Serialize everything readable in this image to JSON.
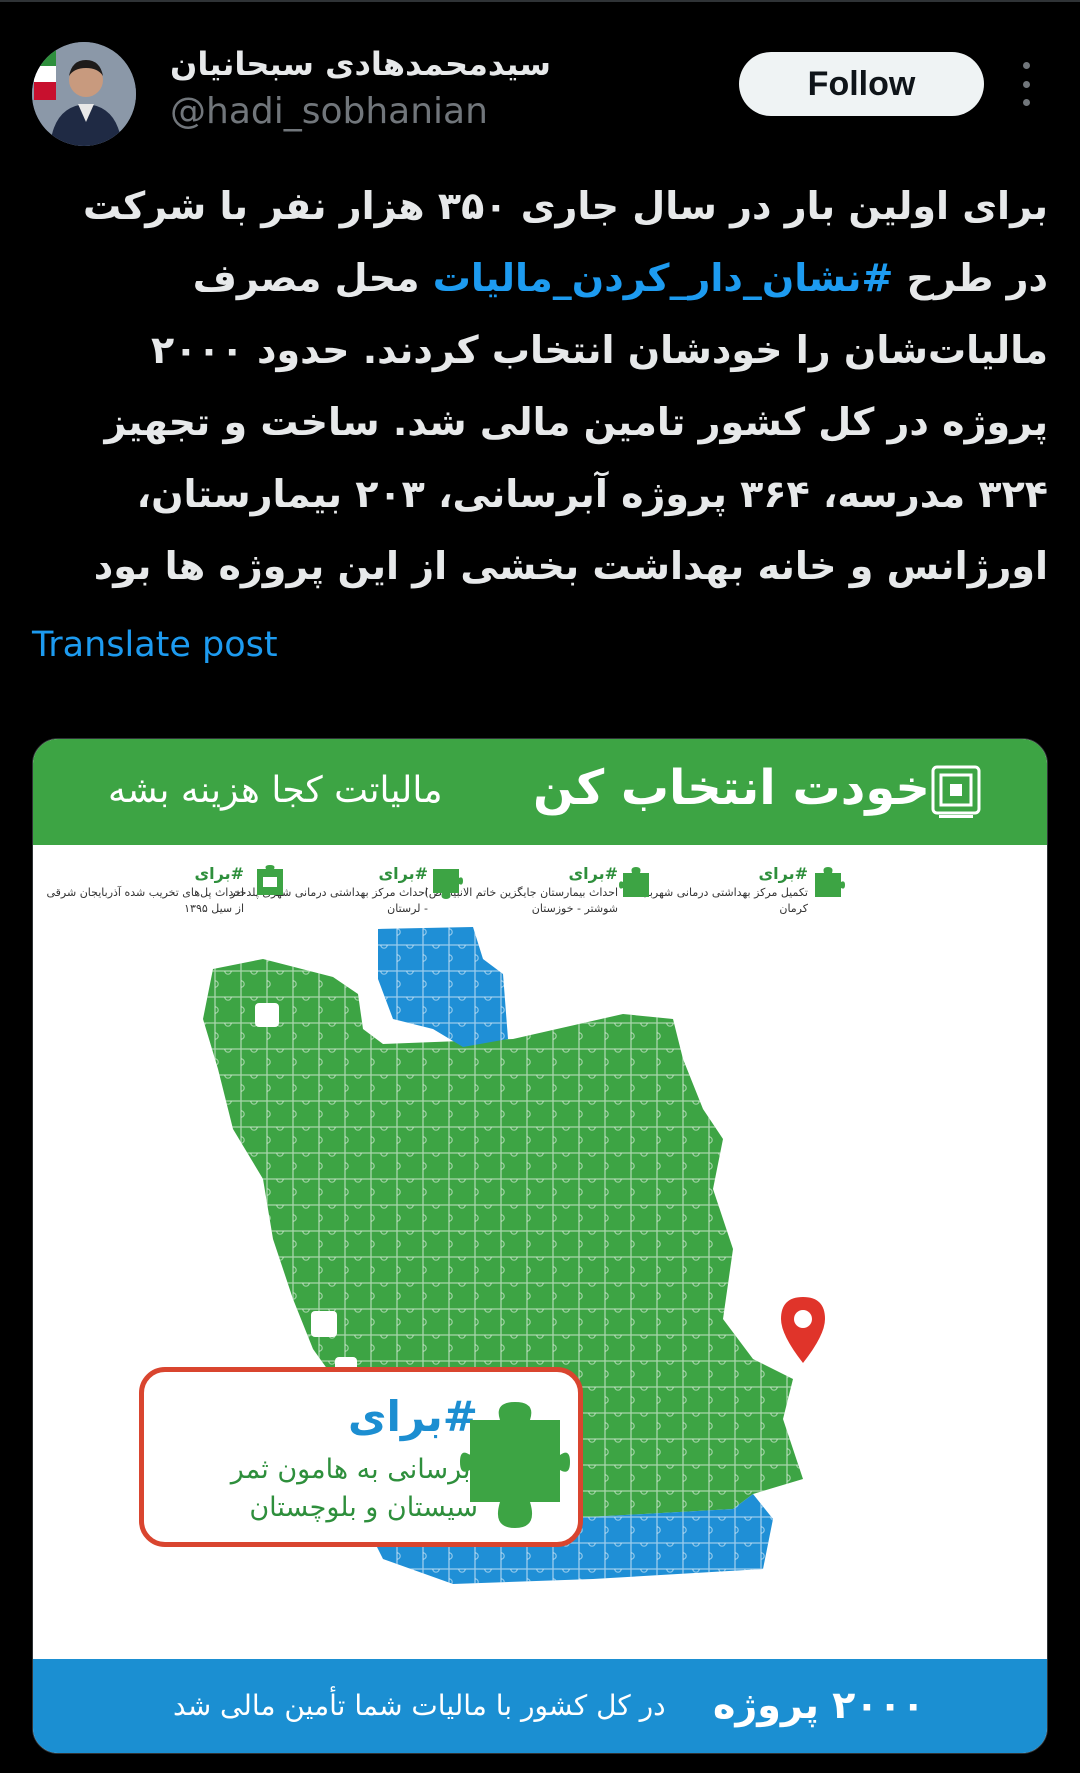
{
  "author": {
    "display_name": "سیدمحمدهادی سبحانیان",
    "handle": "@hadi_sobhanian",
    "avatar_icon": "profile-photo-with-iran-flag"
  },
  "follow_label": "Follow",
  "more_icon": "vertical-ellipsis-icon",
  "tweet": {
    "text_before": "برای اولین بار در سال جاری ۳۵۰ هزار نفر با شرکت در طرح ",
    "hashtag": "#نشان_دار_کردن_مالیات",
    "text_after": " محل مصرف مالیات‌شان را خودشان انتخاب کردند. حدود ۲۰۰۰ پروژه در کل کشور تامین مالی شد. ساخت و تجهیز ۳۲۴ مدرسه، ۳۶۴ پروژه آبرسانی، ۲۰۳ بیمارستان، اورژانس و خانه بهداشت بخشی از این پروژه ها بود",
    "hashtag_color": "#1d9bf0"
  },
  "translate_label": "Translate post",
  "media": {
    "header_bold": "خودت انتخاب کن",
    "header_light": "مالیاتت کجا هزینه بشه",
    "header_color": "#3da444",
    "projects": [
      {
        "tag": "#برای",
        "text": "تکمیل مرکز بهداشتی درمانی شهربابک - کرمان"
      },
      {
        "tag": "#برای",
        "text": "احداث بیمارستان جایگزین خاتم الانبیا (ص) شوشتر - خوزستان"
      },
      {
        "tag": "#برای",
        "text": "احداث مرکز بهداشتی درمانی شهری پلدختر - لرستان"
      },
      {
        "tag": "#برای",
        "text": "احداث پل‌های تخریب شده آذربایجان شرقی از سیل ۱۳۹۵"
      }
    ],
    "callout": {
      "tag": "#برای",
      "line1": "آبرسانی به هامون ثمر",
      "line2": "سیستان و بلوچستان"
    },
    "map_colors": {
      "green": "#3da444",
      "blue": "#1f8fd6",
      "pin": "#e0342a"
    },
    "footer_bold": "۲۰۰۰ پروژه",
    "footer_light": "در کل کشور با مالیات شما تأمین مالی شد",
    "footer_color": "#1b8fd2"
  }
}
